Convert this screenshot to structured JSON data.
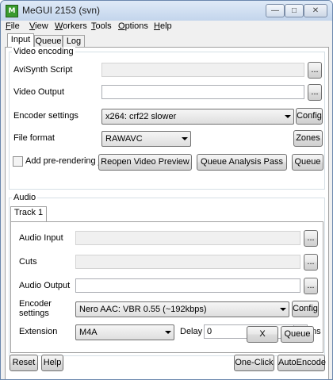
{
  "window": {
    "title": "MeGUI 2153 (svn)",
    "icon_text": "M",
    "controls": {
      "minimize": "—",
      "maximize": "□",
      "close": "✕"
    }
  },
  "menu": [
    {
      "label": "File",
      "hotkey": "F",
      "rest": "ile"
    },
    {
      "label": "View",
      "hotkey": "V",
      "rest": "iew"
    },
    {
      "label": "Workers",
      "hotkey": "W",
      "rest": "orkers"
    },
    {
      "label": "Tools",
      "hotkey": "T",
      "rest": "ools"
    },
    {
      "label": "Options",
      "hotkey": "O",
      "rest": "ptions"
    },
    {
      "label": "Help",
      "hotkey": "H",
      "rest": "elp"
    }
  ],
  "tabs": [
    "Input",
    "Queue",
    "Log"
  ],
  "video": {
    "group_label": "Video encoding",
    "avisynth_label": "AviSynth Script",
    "avisynth_value": "",
    "output_label": "Video Output",
    "output_value": "",
    "encoder_label": "Encoder settings",
    "encoder_value": "x264: crf22 slower",
    "config_button": "Config",
    "format_label": "File format",
    "format_value": "RAWAVC",
    "zones_button": "Zones",
    "prerender_label": "Add pre-rendering job",
    "prerender_checked": false,
    "reopen_button": "Reopen Video Preview",
    "analysis_button": "Queue Analysis Pass",
    "queue_button": "Queue",
    "browse": "..."
  },
  "audio": {
    "group_label": "Audio",
    "track_tab": "Track 1",
    "input_label": "Audio Input",
    "cuts_label": "Cuts",
    "output_label": "Audio Output",
    "encoder_label_line1": "Encoder",
    "encoder_label_line2": "settings",
    "encoder_value": "Nero AAC: VBR 0.55 (~192kbps)",
    "config_button": "Config",
    "extension_label": "Extension",
    "extension_value": "M4A",
    "delay_label": "Delay",
    "delay_value": "0",
    "delay_unit": "ms",
    "x_button": "X",
    "queue_button": "Queue",
    "browse": "..."
  },
  "footer": {
    "reset_button": "Reset",
    "help_button": "Help",
    "oneclick_button": "One-Click",
    "autoencode_button": "AutoEncode"
  }
}
